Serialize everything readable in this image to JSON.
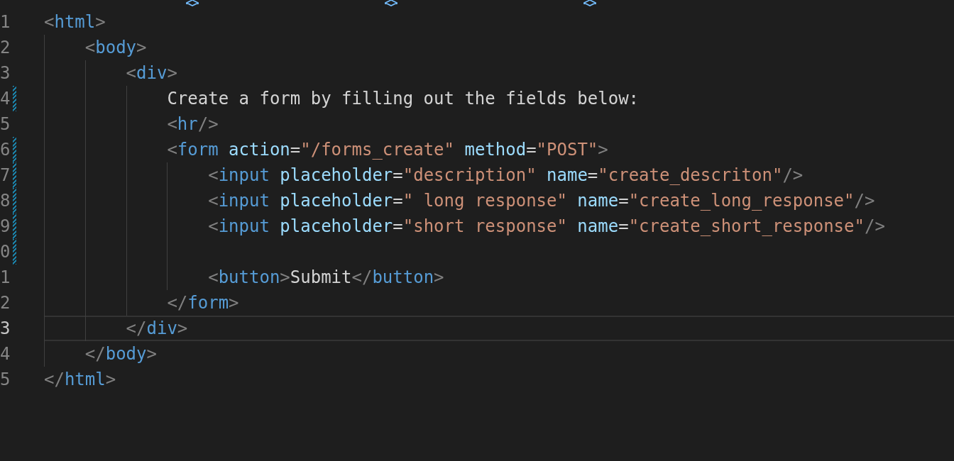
{
  "lines": [
    {
      "number": "1",
      "modified": false,
      "current": false,
      "tokens": [
        {
          "kind": "punct",
          "text": "<"
        },
        {
          "kind": "tag",
          "text": "html"
        },
        {
          "kind": "punct",
          "text": ">"
        }
      ]
    },
    {
      "number": "2",
      "modified": false,
      "current": false,
      "tokens": [
        {
          "kind": "punct",
          "text": "    <"
        },
        {
          "kind": "tag",
          "text": "body"
        },
        {
          "kind": "punct",
          "text": ">"
        }
      ]
    },
    {
      "number": "3",
      "modified": false,
      "current": false,
      "tokens": [
        {
          "kind": "punct",
          "text": "        <"
        },
        {
          "kind": "tag",
          "text": "div"
        },
        {
          "kind": "punct",
          "text": ">"
        }
      ]
    },
    {
      "number": "4",
      "modified": true,
      "current": false,
      "tokens": [
        {
          "kind": "text",
          "text": "            Create a form by filling out the fields below:"
        }
      ]
    },
    {
      "number": "5",
      "modified": false,
      "current": false,
      "tokens": [
        {
          "kind": "punct",
          "text": "            <"
        },
        {
          "kind": "tag",
          "text": "hr"
        },
        {
          "kind": "punct",
          "text": "/>"
        }
      ]
    },
    {
      "number": "6",
      "modified": true,
      "current": false,
      "tokens": [
        {
          "kind": "punct",
          "text": "            <"
        },
        {
          "kind": "tag",
          "text": "form"
        },
        {
          "kind": "attr",
          "text": " action"
        },
        {
          "kind": "text",
          "text": "="
        },
        {
          "kind": "string",
          "text": "\"/forms_create\""
        },
        {
          "kind": "attr",
          "text": " method"
        },
        {
          "kind": "text",
          "text": "="
        },
        {
          "kind": "string",
          "text": "\"POST\""
        },
        {
          "kind": "punct",
          "text": ">"
        }
      ]
    },
    {
      "number": "7",
      "modified": true,
      "current": false,
      "tokens": [
        {
          "kind": "punct",
          "text": "                <"
        },
        {
          "kind": "tag",
          "text": "input"
        },
        {
          "kind": "attr",
          "text": " placeholder"
        },
        {
          "kind": "text",
          "text": "="
        },
        {
          "kind": "string",
          "text": "\"description\""
        },
        {
          "kind": "attr",
          "text": " name"
        },
        {
          "kind": "text",
          "text": "="
        },
        {
          "kind": "string",
          "text": "\"create_descriton\""
        },
        {
          "kind": "punct",
          "text": "/>"
        }
      ]
    },
    {
      "number": "8",
      "modified": true,
      "current": false,
      "tokens": [
        {
          "kind": "punct",
          "text": "                <"
        },
        {
          "kind": "tag",
          "text": "input"
        },
        {
          "kind": "attr",
          "text": " placeholder"
        },
        {
          "kind": "text",
          "text": "="
        },
        {
          "kind": "string",
          "text": "\" long response\""
        },
        {
          "kind": "attr",
          "text": " name"
        },
        {
          "kind": "text",
          "text": "="
        },
        {
          "kind": "string",
          "text": "\"create_long_response\""
        },
        {
          "kind": "punct",
          "text": "/>"
        }
      ]
    },
    {
      "number": "9",
      "modified": true,
      "current": false,
      "tokens": [
        {
          "kind": "punct",
          "text": "                <"
        },
        {
          "kind": "tag",
          "text": "input"
        },
        {
          "kind": "attr",
          "text": " placeholder"
        },
        {
          "kind": "text",
          "text": "="
        },
        {
          "kind": "string",
          "text": "\"short response\""
        },
        {
          "kind": "attr",
          "text": " name"
        },
        {
          "kind": "text",
          "text": "="
        },
        {
          "kind": "string",
          "text": "\"create_short_response\""
        },
        {
          "kind": "punct",
          "text": "/>"
        }
      ]
    },
    {
      "number": "0",
      "modified": true,
      "current": false
    },
    {
      "number": "1",
      "modified": false,
      "current": false,
      "tokens": [
        {
          "kind": "punct",
          "text": "                <"
        },
        {
          "kind": "tag",
          "text": "button"
        },
        {
          "kind": "punct",
          "text": ">"
        },
        {
          "kind": "text",
          "text": "Submit"
        },
        {
          "kind": "punct",
          "text": "</"
        },
        {
          "kind": "tag",
          "text": "button"
        },
        {
          "kind": "punct",
          "text": ">"
        }
      ]
    },
    {
      "number": "2",
      "modified": false,
      "current": false,
      "tokens": [
        {
          "kind": "punct",
          "text": "            </"
        },
        {
          "kind": "tag",
          "text": "form"
        },
        {
          "kind": "punct",
          "text": ">"
        }
      ]
    },
    {
      "number": "3",
      "modified": false,
      "current": true,
      "tokens": [
        {
          "kind": "punct",
          "text": "        </"
        },
        {
          "kind": "tag",
          "text": "div"
        },
        {
          "kind": "punct",
          "text": ">"
        }
      ]
    },
    {
      "number": "4",
      "modified": false,
      "current": false,
      "tokens": [
        {
          "kind": "punct",
          "text": "    </"
        },
        {
          "kind": "tag",
          "text": "body"
        },
        {
          "kind": "punct",
          "text": ">"
        }
      ]
    },
    {
      "number": "5",
      "modified": false,
      "current": false,
      "tokens": [
        {
          "kind": "punct",
          "text": "</"
        },
        {
          "kind": "tag",
          "text": "html"
        },
        {
          "kind": "punct",
          "text": ">"
        }
      ]
    }
  ]
}
